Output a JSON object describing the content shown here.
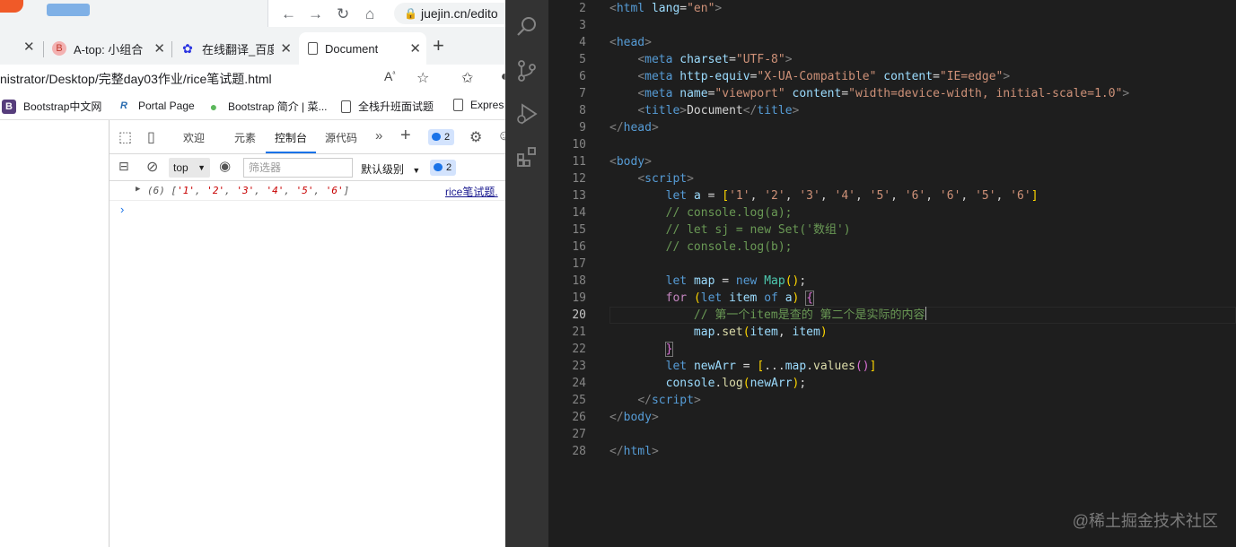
{
  "browser": {
    "mini_address": "juejin.cn/edito",
    "tabs": [
      {
        "label": "A-top: 小组合",
        "icon": "ant-icon"
      },
      {
        "label": "在线翻译_百度",
        "icon": "baidu-paw-icon"
      },
      {
        "label": "Document",
        "icon": "page-icon"
      }
    ],
    "address_path": "nistrator/Desktop/完整day03作业/rice笔试题.html",
    "bookmarks": [
      {
        "label": "Bootstrap中文网",
        "icon_text": "B"
      },
      {
        "label": "Portal Page",
        "icon_text": "R"
      },
      {
        "label": "Bootstrap 简介 | 菜...",
        "icon_text": "●"
      },
      {
        "label": "全栈升班面试题",
        "icon_text": ""
      },
      {
        "label": "Expres",
        "icon_text": ""
      }
    ]
  },
  "devtools": {
    "tabs": [
      "欢迎",
      "元素",
      "控制台",
      "源代码"
    ],
    "active_tab": "控制台",
    "issues_count": "2",
    "context": "top",
    "filter_placeholder": "筛选器",
    "level": "默认级别",
    "console_issues": "2",
    "log": {
      "prefix": "(6) [",
      "items": [
        "'1'",
        "'2'",
        "'3'",
        "'4'",
        "'5'",
        "'6'"
      ],
      "suffix": "]",
      "source": "rice笔试题."
    },
    "prompt": "›"
  },
  "editor": {
    "current_line": 20,
    "watermark": "@稀土掘金技术社区",
    "line_numbers": [
      "2",
      "3",
      "4",
      "5",
      "6",
      "7",
      "8",
      "9",
      "10",
      "11",
      "12",
      "13",
      "14",
      "15",
      "16",
      "17",
      "18",
      "19",
      "20",
      "21",
      "22",
      "23",
      "24",
      "25",
      "26",
      "27",
      "28"
    ]
  }
}
